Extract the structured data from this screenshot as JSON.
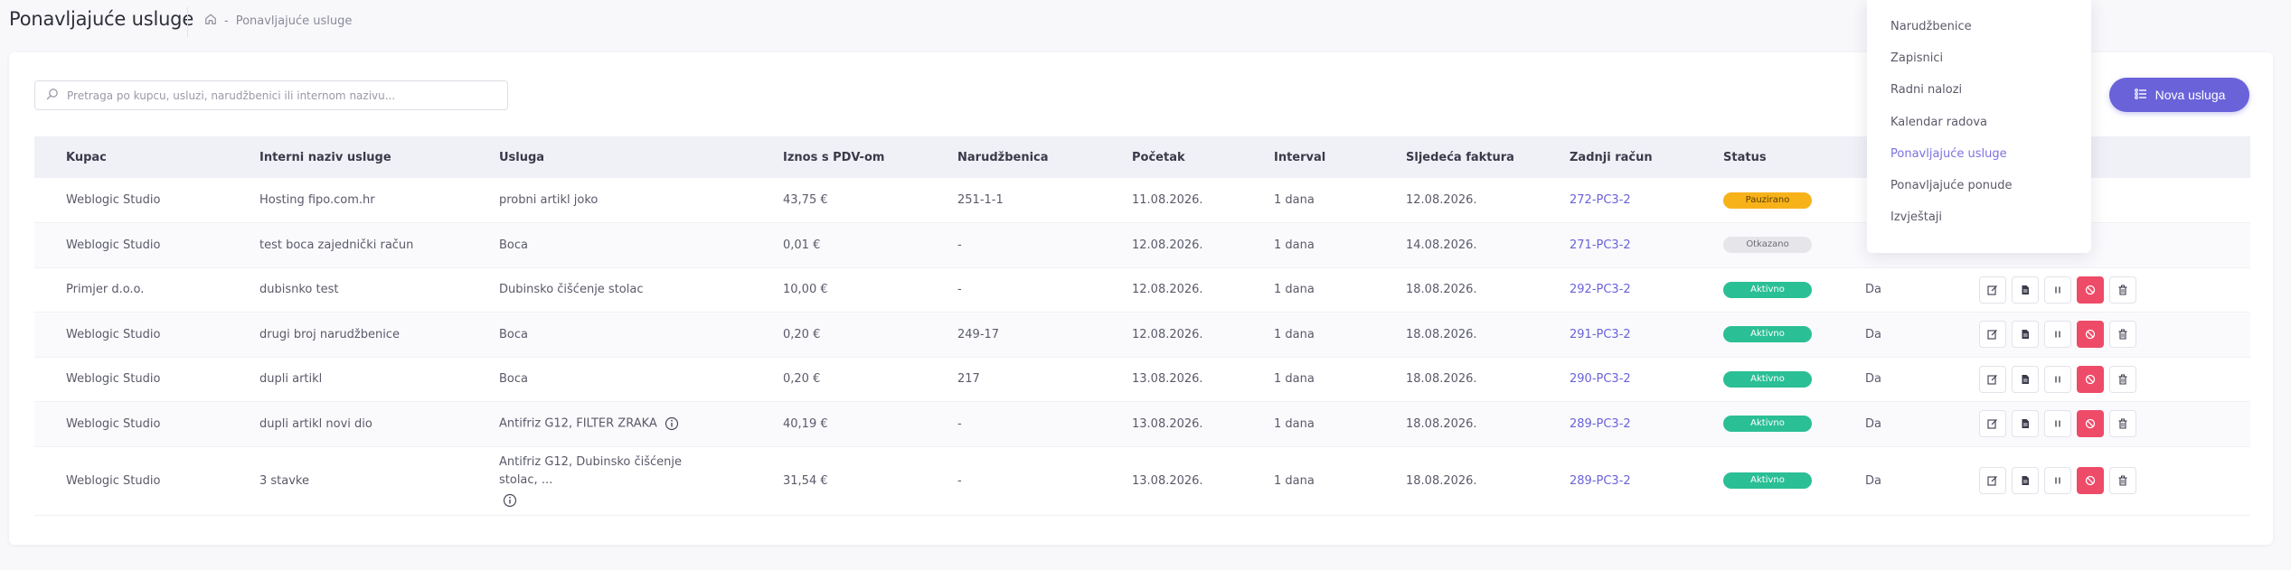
{
  "header": {
    "title": "Ponavljajuće usluge",
    "breadcrumb_sep": "-",
    "breadcrumb_current": "Ponavljajuće usluge"
  },
  "search": {
    "placeholder": "Pretraga po kupcu, usluzi, narudžbenici ili internom nazivu..."
  },
  "new_button": {
    "label": "Nova usluga"
  },
  "colors": {
    "accent": "#6a62d9",
    "paused": "#f7b21a",
    "active": "#2bbf95",
    "cancelled": "#e6e6ea",
    "danger": "#ee4b68"
  },
  "table": {
    "columns": [
      "Kupac",
      "Interni naziv usluge",
      "Usluga",
      "Iznos s PDV-om",
      "Narudžbenica",
      "Početak",
      "Interval",
      "Sljedeća faktura",
      "Zadnji račun",
      "Status"
    ],
    "rows": [
      {
        "kupac": "Weblogic Studio",
        "interni": "Hosting fipo.com.hr",
        "usluga": "probni artikl joko",
        "iznos": "43,75 €",
        "narudzbenica": "251-1-1",
        "pocetak": "11.08.2026.",
        "interval": "1 dana",
        "sljedeca": "12.08.2026.",
        "racun": "272-PC3-2",
        "status": "Pauzirano",
        "extra": ""
      },
      {
        "kupac": "Weblogic Studio",
        "interni": "test boca zajednički račun",
        "usluga": "Boca",
        "iznos": "0,01 €",
        "narudzbenica": "-",
        "pocetak": "12.08.2026.",
        "interval": "1 dana",
        "sljedeca": "14.08.2026.",
        "racun": "271-PC3-2",
        "status": "Otkazano",
        "extra": ""
      },
      {
        "kupac": "Primjer d.o.o.",
        "interni": "dubisnko test",
        "usluga": "Dubinsko čišćenje stolac",
        "iznos": "10,00 €",
        "narudzbenica": "-",
        "pocetak": "12.08.2026.",
        "interval": "1 dana",
        "sljedeca": "18.08.2026.",
        "racun": "292-PC3-2",
        "status": "Aktivno",
        "extra": "Da"
      },
      {
        "kupac": "Weblogic Studio",
        "interni": "drugi broj narudžbenice",
        "usluga": "Boca",
        "iznos": "0,20 €",
        "narudzbenica": "249-17",
        "pocetak": "12.08.2026.",
        "interval": "1 dana",
        "sljedeca": "18.08.2026.",
        "racun": "291-PC3-2",
        "status": "Aktivno",
        "extra": "Da"
      },
      {
        "kupac": "Weblogic Studio",
        "interni": "dupli artikl",
        "usluga": "Boca",
        "iznos": "0,20 €",
        "narudzbenica": "217",
        "pocetak": "13.08.2026.",
        "interval": "1 dana",
        "sljedeca": "18.08.2026.",
        "racun": "290-PC3-2",
        "status": "Aktivno",
        "extra": "Da"
      },
      {
        "kupac": "Weblogic Studio",
        "interni": "dupli artikl novi dio",
        "usluga": "Antifriz G12, FILTER ZRAKA",
        "iznos": "40,19 €",
        "narudzbenica": "-",
        "pocetak": "13.08.2026.",
        "interval": "1 dana",
        "sljedeca": "18.08.2026.",
        "racun": "289-PC3-2",
        "status": "Aktivno",
        "extra": "Da"
      },
      {
        "kupac": "Weblogic Studio",
        "interni": "3 stavke",
        "usluga": "Antifriz G12, Dubinsko čišćenje stolac, ...",
        "iznos": "31,54 €",
        "narudzbenica": "-",
        "pocetak": "13.08.2026.",
        "interval": "1 dana",
        "sljedeca": "18.08.2026.",
        "racun": "289-PC3-2",
        "status": "Aktivno",
        "extra": "Da"
      }
    ]
  },
  "menu": {
    "items": [
      "Narudžbenice",
      "Zapisnici",
      "Radni nalozi",
      "Kalendar radova",
      "Ponavljajuće usluge",
      "Ponavljajuće ponude",
      "Izvještaji"
    ],
    "active_index": 4
  }
}
